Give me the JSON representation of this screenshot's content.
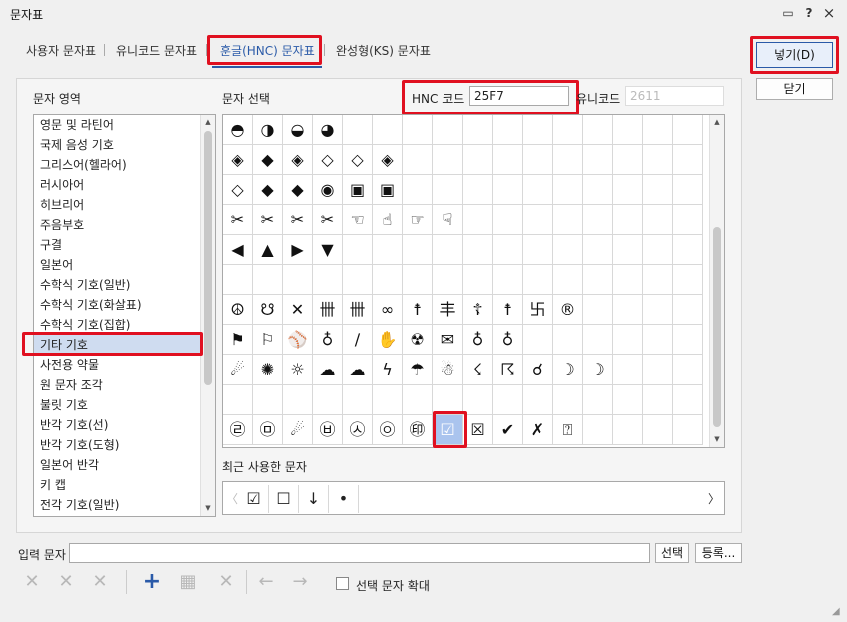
{
  "window": {
    "title": "문자표",
    "help": "?",
    "close": "×",
    "menu": "▭"
  },
  "tabs": [
    {
      "label": "사용자 문자표"
    },
    {
      "label": "유니코드 문자표"
    },
    {
      "label": "훈글(HNC) 문자표",
      "active": true
    },
    {
      "label": "완성형(KS) 문자표"
    }
  ],
  "area": {
    "label": "문자 영역",
    "items": [
      "영문 및 라틴어",
      "국제 음성 기호",
      "그리스어(헬라어)",
      "러시아어",
      "히브리어",
      "주음부호",
      "구결",
      "일본어",
      "수학식 기호(일반)",
      "수학식 기호(화살표)",
      "수학식 기호(집합)",
      "기타 기호",
      "사전용 약물",
      "원 문자 조각",
      "불릿 기호",
      "반각 기호(선)",
      "반각 기호(도형)",
      "일본어 반각",
      "키 캡",
      "전각 기호(일반)"
    ],
    "selected_index": 11
  },
  "select": {
    "label": "문자 선택",
    "hnc_label": "HNC 코드",
    "hnc_value": "25F7",
    "unicode_label": "유니코드",
    "unicode_value": "2611",
    "rows": [
      [
        "◓",
        "◑",
        "◒",
        "◕",
        "",
        "",
        "",
        "",
        "",
        "",
        "",
        "",
        "",
        "",
        "",
        ""
      ],
      [
        "◈",
        "◆",
        "◈",
        "◇",
        "◇",
        "◈",
        "",
        "",
        "",
        "",
        "",
        "",
        "",
        "",
        "",
        ""
      ],
      [
        "◇",
        "◆",
        "◆",
        "◉",
        "▣",
        "▣",
        "",
        "",
        "",
        "",
        "",
        "",
        "",
        "",
        "",
        ""
      ],
      [
        "✂",
        "✂",
        "✂",
        "✂",
        "☜",
        "☝",
        "☞",
        "☟",
        "",
        "",
        "",
        "",
        "",
        "",
        "",
        ""
      ],
      [
        "◀",
        "▲",
        "▶",
        "▼",
        "",
        "",
        "",
        "",
        "",
        "",
        "",
        "",
        "",
        "",
        "",
        ""
      ],
      [
        "",
        "",
        "",
        "",
        "",
        "",
        "",
        "",
        "",
        "",
        "",
        "",
        "",
        "",
        "",
        ""
      ],
      [
        "☮",
        "☋",
        "✕",
        "卌",
        "卌",
        "∞",
        "☨",
        "丰",
        "☦",
        "☨",
        "卐",
        "®",
        "",
        "",
        "",
        ""
      ],
      [
        "⚑",
        "⚐",
        "⚾",
        "♁",
        "∕",
        "✋",
        "☢",
        "✉",
        "♁",
        "♁",
        "",
        "",
        "",
        "",
        "",
        ""
      ],
      [
        "☄",
        "✺",
        "☼",
        "☁",
        "☁",
        "ϟ",
        "☂",
        "☃",
        "☇",
        "☈",
        "☌",
        "☽",
        "☽",
        "",
        "",
        ""
      ],
      [
        "",
        "",
        "",
        "",
        "",
        "",
        "",
        "",
        "",
        "",
        "",
        "",
        "",
        "",
        "",
        ""
      ],
      [
        "㉣",
        "㉤",
        "☄",
        "㉥",
        "㉦",
        "㉧",
        "㊞",
        "☑",
        "☒",
        "✔",
        "✗",
        "⍰",
        "",
        "",
        "",
        ""
      ]
    ],
    "selected_row": 10,
    "selected_col": 7
  },
  "recent": {
    "label": "최근 사용한 문자",
    "items": [
      "☑",
      "☐",
      "↓",
      "•"
    ],
    "left_arrow": "〈",
    "right_arrow": "〉"
  },
  "buttons": {
    "insert": "넣기(D)",
    "close": "닫기",
    "select": "선택",
    "register": "등록..."
  },
  "input": {
    "label": "입력 문자",
    "value": ""
  },
  "expand_label": "선택 문자 확대"
}
